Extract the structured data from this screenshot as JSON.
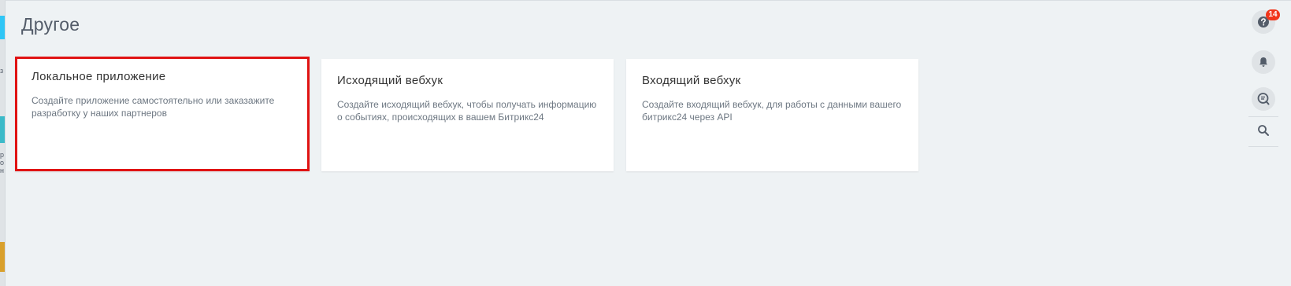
{
  "page": {
    "title": "Другое"
  },
  "cards": [
    {
      "title": "Локальное приложение",
      "description": "Создайте приложение самостоятельно или заказажите разработку у наших партнеров",
      "selected": true
    },
    {
      "title": "Исходящий вебхук",
      "description": "Создайте исходящий вебхук, чтобы получать информацию о событиях, происходящих в вашем Битрикс24",
      "selected": false
    },
    {
      "title": "Входящий вебхук",
      "description": "Создайте входящий вебхук, для работы с данными вашего битрикс24 через API",
      "selected": false
    }
  ],
  "right_panel": {
    "help_badge": "14",
    "icons": [
      "help-icon",
      "bell-icon",
      "chat-search-icon",
      "search-icon"
    ]
  },
  "colors": {
    "background": "#eef2f4",
    "selection_border": "#e01313",
    "badge": "#f1361b"
  }
}
